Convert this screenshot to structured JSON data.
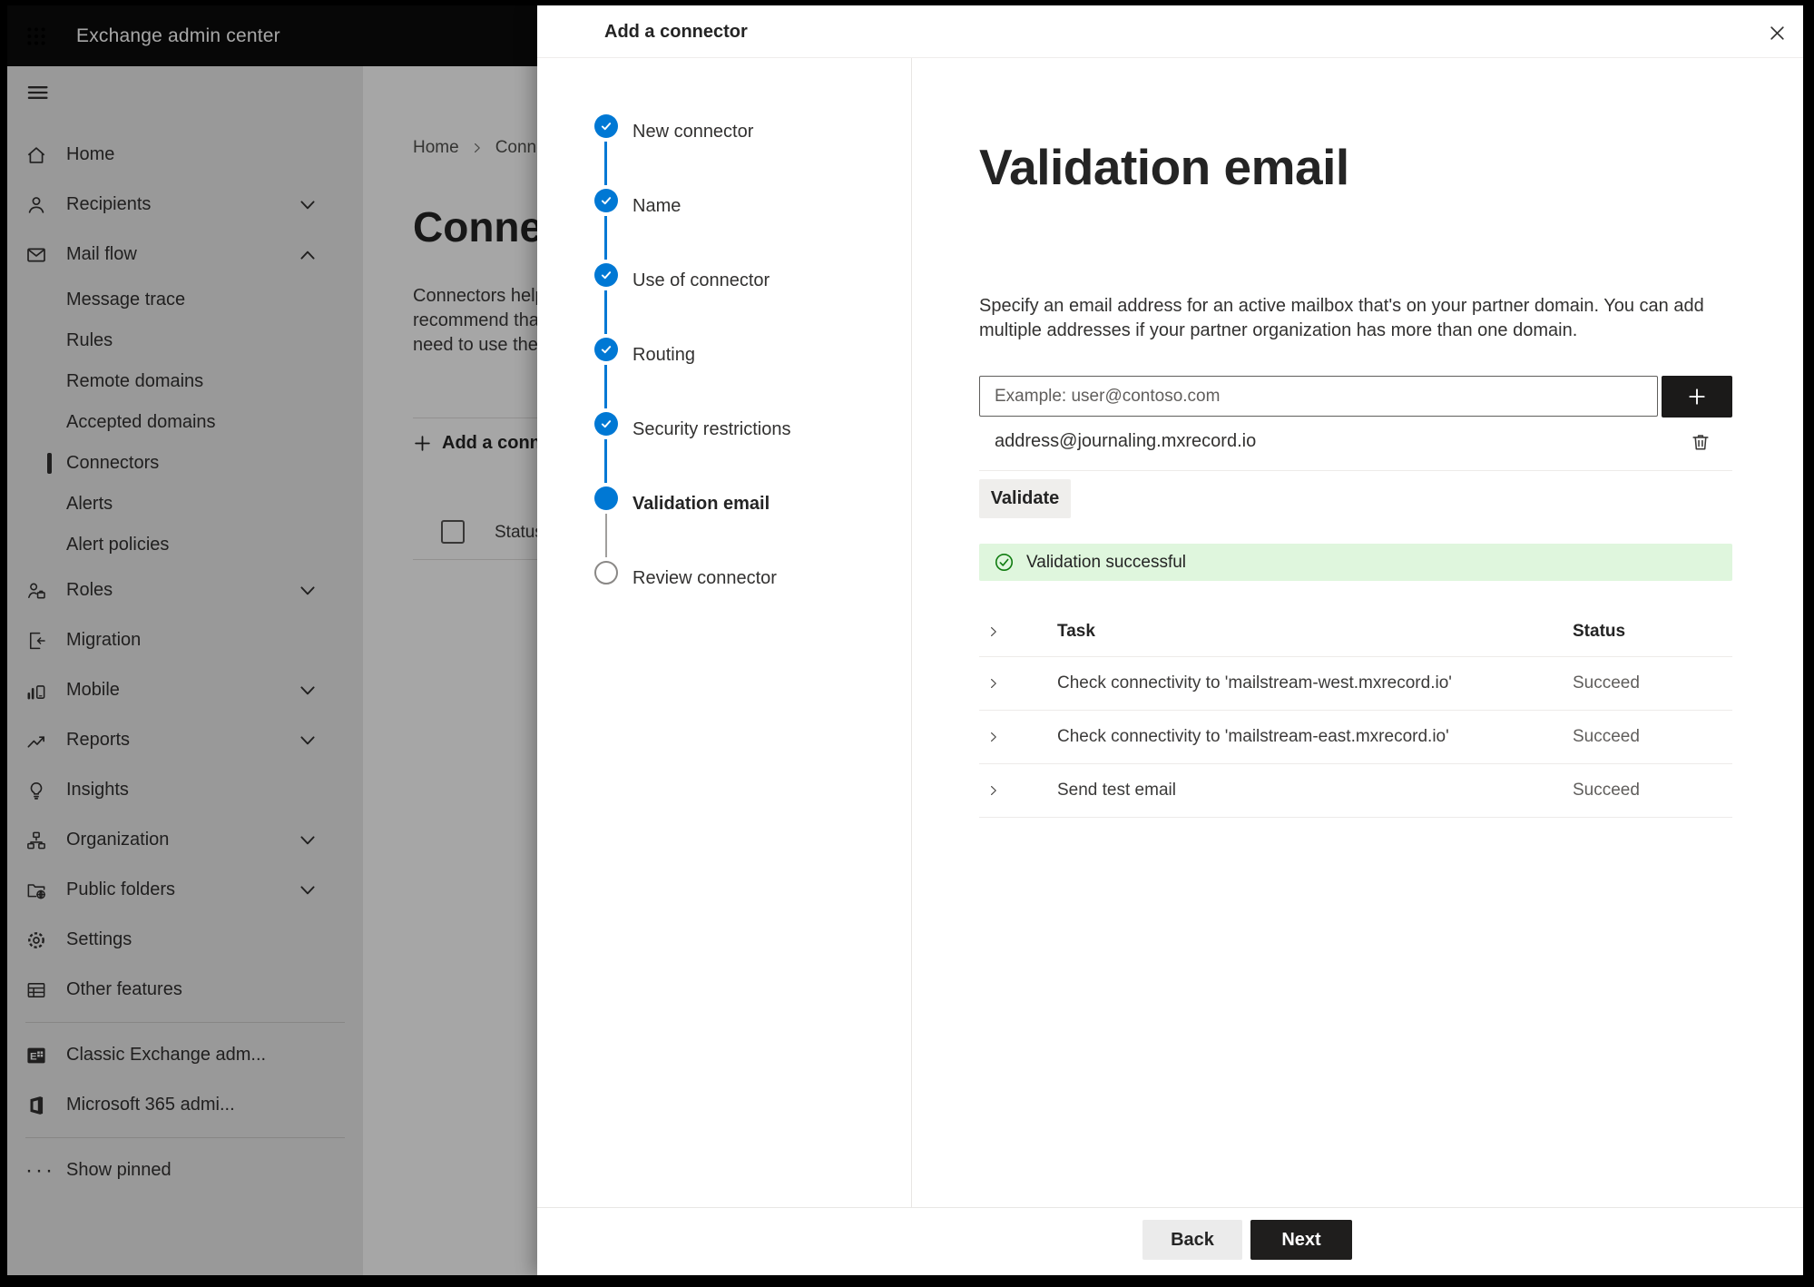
{
  "topbar": {
    "title": "Exchange admin center"
  },
  "sidebar": {
    "items": [
      {
        "label": "Home",
        "icon": "home"
      },
      {
        "label": "Recipients",
        "icon": "person",
        "chevron": "down"
      },
      {
        "label": "Mail flow",
        "icon": "mail",
        "chevron": "up"
      },
      {
        "label": "Message trace",
        "sub": true
      },
      {
        "label": "Rules",
        "sub": true
      },
      {
        "label": "Remote domains",
        "sub": true
      },
      {
        "label": "Accepted domains",
        "sub": true
      },
      {
        "label": "Connectors",
        "sub": true,
        "selected": true
      },
      {
        "label": "Alerts",
        "sub": true
      },
      {
        "label": "Alert policies",
        "sub": true
      },
      {
        "label": "Roles",
        "icon": "roles",
        "chevron": "down"
      },
      {
        "label": "Migration",
        "icon": "migration"
      },
      {
        "label": "Mobile",
        "icon": "mobile",
        "chevron": "down"
      },
      {
        "label": "Reports",
        "icon": "reports",
        "chevron": "down"
      },
      {
        "label": "Insights",
        "icon": "insights"
      },
      {
        "label": "Organization",
        "icon": "organization",
        "chevron": "down"
      },
      {
        "label": "Public folders",
        "icon": "public-folders",
        "chevron": "down"
      },
      {
        "label": "Settings",
        "icon": "settings"
      },
      {
        "label": "Other features",
        "icon": "other-features"
      },
      {
        "label": "Classic Exchange adm...",
        "icon": "exchange-logo"
      },
      {
        "label": "Microsoft 365 admi...",
        "icon": "office-logo"
      },
      {
        "label": "Show pinned",
        "icon": "ellipsis"
      }
    ]
  },
  "background_page": {
    "breadcrumb": [
      "Home",
      "Conne"
    ],
    "title": "Connec",
    "description_lines": [
      "Connectors help",
      "recommend tha",
      "need to use ther"
    ],
    "add_button": "Add a conn",
    "table_header": "Status"
  },
  "panel": {
    "title": "Add a connector",
    "heading": "Validation email",
    "description": "Specify an email address for an active mailbox that's on your partner domain. You can add multiple addresses if your partner organization has more than one domain.",
    "email_input": {
      "value": "",
      "placeholder": "Example: user@contoso.com"
    },
    "address": "address@journaling.mxrecord.io",
    "validate_button": "Validate",
    "banner": {
      "text": "Validation successful"
    },
    "footer": {
      "back": "Back",
      "next": "Next"
    }
  },
  "wizard": {
    "steps": [
      {
        "label": "New connector",
        "state": "done"
      },
      {
        "label": "Name",
        "state": "done"
      },
      {
        "label": "Use of connector",
        "state": "done"
      },
      {
        "label": "Routing",
        "state": "done"
      },
      {
        "label": "Security restrictions",
        "state": "done"
      },
      {
        "label": "Validation email",
        "state": "current"
      },
      {
        "label": "Review connector",
        "state": "upcoming"
      }
    ]
  },
  "tasks": {
    "columns": [
      "Task",
      "Status"
    ],
    "rows": [
      {
        "task": "Check connectivity to 'mailstream-west.mxrecord.io'",
        "status": "Succeed"
      },
      {
        "task": "Check connectivity to 'mailstream-east.mxrecord.io'",
        "status": "Succeed"
      },
      {
        "task": "Send test email",
        "status": "Succeed"
      }
    ]
  },
  "icons": {
    "app_launcher": "grid-dots-3x3",
    "nav_toggle": "hamburger",
    "breadcrumb_separator": "chevron-right",
    "add_address": "plus",
    "delete_address": "trash",
    "success": "circle-check",
    "expand_row": "chevron-right",
    "close_panel": "x"
  },
  "colors": {
    "accent": "#0078d4",
    "success_icon": "#107c10",
    "success_bg": "#dff6dd",
    "topbar_bg": "#0c0c0c"
  }
}
